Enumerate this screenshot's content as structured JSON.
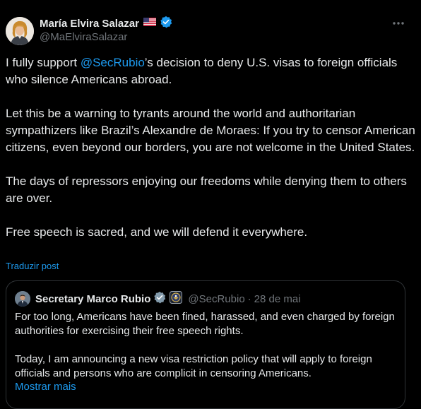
{
  "post": {
    "author": {
      "display_name": "María Elvira Salazar",
      "flag_emoji": "🇺🇸",
      "verified_icon": "verified-badge-icon",
      "handle": "@MaElviraSalazar"
    },
    "more_icon": "more-options-icon",
    "body": {
      "p1_before": "I fully support ",
      "p1_mention": "@SecRubio",
      "p1_after": "’s decision to deny U.S. visas to foreign officials who silence Americans abroad.",
      "p2": "Let this be a warning to tyrants around the world and authoritarian sympathizers like Brazil’s Alexandre de Moraes: If you try to censor American citizens, even beyond our borders, you are not welcome in the United States.",
      "p3": "The days of repressors enjoying our freedoms while denying them to others are over.",
      "p4": "Free speech is sacred, and we will defend it everywhere."
    },
    "translate_label": "Traduzir post"
  },
  "quote": {
    "author": {
      "display_name": "Secretary Marco Rubio",
      "verified_icon": "verified-badge-icon",
      "affiliation_icon": "government-seal-icon",
      "handle": "@SecRubio",
      "separator": "·",
      "date": "28 de mai"
    },
    "body": {
      "p1": "For too long, Americans have been fined, harassed, and even charged by foreign authorities for exercising their free speech rights.",
      "p2": "Today, I am announcing a new visa restriction policy that will apply to foreign officials and persons who are complicit in censoring Americans."
    },
    "show_more_label": "Mostrar mais"
  },
  "colors": {
    "background": "#000000",
    "text": "#e7e9ea",
    "secondary_text": "#71767b",
    "accent": "#1d9bf0",
    "border": "#2f3336"
  }
}
